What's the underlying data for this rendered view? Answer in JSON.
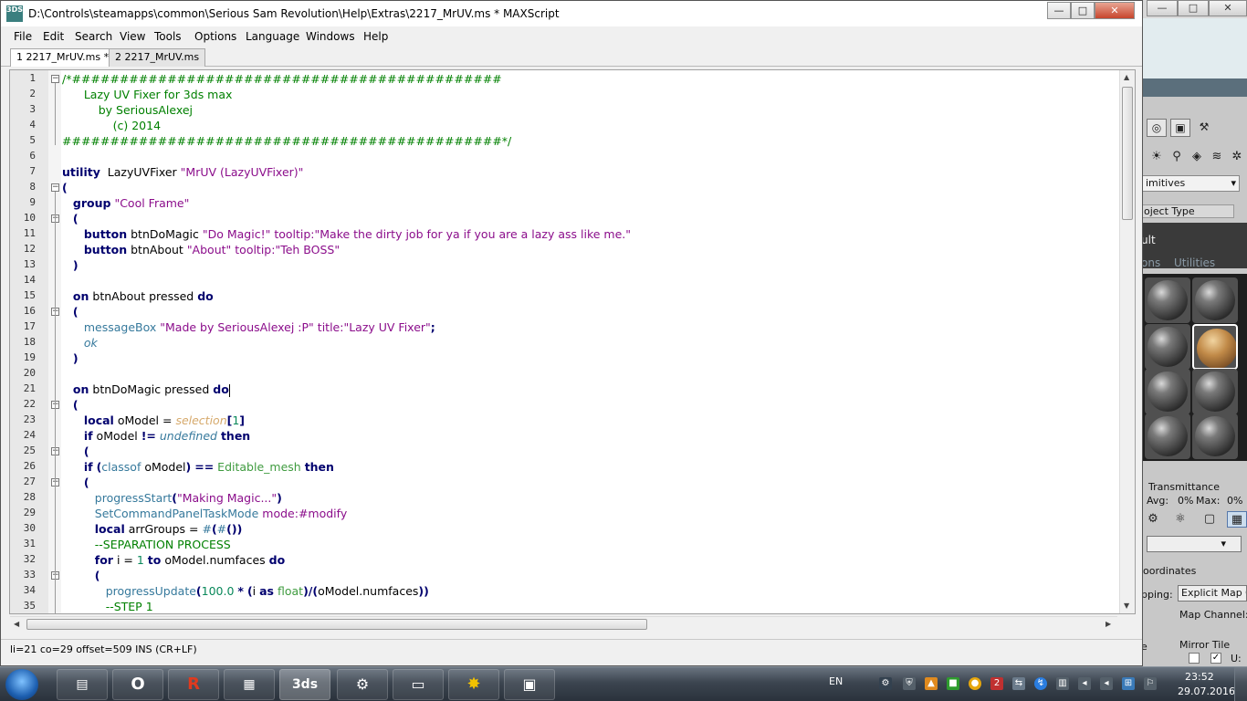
{
  "window": {
    "title": "D:\\Controls\\steamapps\\common\\Serious Sam Revolution\\Help\\Extras\\2217_MrUV.ms * MAXScript",
    "app_icon_text": "3DS",
    "minimize": "—",
    "maximize": "□",
    "close": "✕"
  },
  "menu": [
    "File",
    "Edit",
    "Search",
    "View",
    "Tools",
    "Options",
    "Language",
    "Windows",
    "Help"
  ],
  "tabs": [
    {
      "label": "1 2217_MrUV.ms *",
      "active": true
    },
    {
      "label": "2 2217_MrUV.ms",
      "active": false
    }
  ],
  "code": {
    "line_numbers": [
      "1",
      "2",
      "3",
      "4",
      "5",
      "6",
      "7",
      "8",
      "9",
      "10",
      "11",
      "12",
      "13",
      "14",
      "15",
      "16",
      "17",
      "18",
      "19",
      "20",
      "21",
      "22",
      "23",
      "24",
      "25",
      "26",
      "27",
      "28",
      "29",
      "30",
      "31",
      "32",
      "33",
      "34",
      "35"
    ],
    "lines": [
      [
        [
          "cm",
          "/*#############################################"
        ]
      ],
      [
        [
          "cm",
          "      Lazy UV Fixer for 3ds max"
        ]
      ],
      [
        [
          "cm",
          "          by SeriousAlexej"
        ]
      ],
      [
        [
          "cm",
          "              (c) 2014"
        ]
      ],
      [
        [
          "cm",
          "##############################################*/"
        ]
      ],
      [],
      [
        [
          "kw",
          "utility"
        ],
        [
          "",
          "  LazyUVFixer "
        ],
        [
          "str",
          "\"MrUV (LazyUVFixer)\""
        ]
      ],
      [
        [
          "kw",
          "("
        ]
      ],
      [
        [
          "",
          "   "
        ],
        [
          "kw",
          "group"
        ],
        [
          "",
          ""
        ],
        [
          "str",
          " \"Cool Frame\""
        ]
      ],
      [
        [
          "",
          "   "
        ],
        [
          "kw",
          "("
        ]
      ],
      [
        [
          "",
          "      "
        ],
        [
          "kw",
          "button"
        ],
        [
          "",
          " btnDoMagic "
        ],
        [
          "str",
          "\"Do Magic!\""
        ],
        [
          "",
          " "
        ],
        [
          "str",
          "tooltip:\"Make the dirty job for ya if you are a lazy ass like me.\""
        ]
      ],
      [
        [
          "",
          "      "
        ],
        [
          "kw",
          "button"
        ],
        [
          "",
          " btnAbout "
        ],
        [
          "str",
          "\"About\""
        ],
        [
          "",
          " "
        ],
        [
          "str",
          "tooltip:\"Teh BOSS\""
        ]
      ],
      [
        [
          "",
          "   "
        ],
        [
          "kw",
          ")"
        ]
      ],
      [],
      [
        [
          "",
          "   "
        ],
        [
          "kw",
          "on"
        ],
        [
          "",
          " btnAbout pressed "
        ],
        [
          "kw",
          "do"
        ]
      ],
      [
        [
          "",
          "   "
        ],
        [
          "kw",
          "("
        ]
      ],
      [
        [
          "",
          "      "
        ],
        [
          "fn",
          "messageBox"
        ],
        [
          "",
          " "
        ],
        [
          "str",
          "\"Made by SeriousAlexej :P\""
        ],
        [
          "",
          " "
        ],
        [
          "str",
          "title:\"Lazy UV Fixer\""
        ],
        [
          "kw",
          ";"
        ]
      ],
      [
        [
          "",
          "      "
        ],
        [
          "undef",
          "ok"
        ]
      ],
      [
        [
          "",
          "   "
        ],
        [
          "kw",
          ")"
        ]
      ],
      [],
      [
        [
          "",
          "   "
        ],
        [
          "kw",
          "on"
        ],
        [
          "",
          " btnDoMagic pressed "
        ],
        [
          "kw",
          "do"
        ],
        [
          "cursor",
          ""
        ]
      ],
      [
        [
          "",
          "   "
        ],
        [
          "kw",
          "("
        ]
      ],
      [
        [
          "",
          "      "
        ],
        [
          "kw",
          "local"
        ],
        [
          "",
          " oModel = "
        ],
        [
          "sel",
          "selection"
        ],
        [
          "kw",
          "["
        ],
        [
          "num",
          "1"
        ],
        [
          "kw",
          "]"
        ]
      ],
      [
        [
          "",
          "      "
        ],
        [
          "kw",
          "if"
        ],
        [
          "",
          " oModel "
        ],
        [
          "kw",
          "!="
        ],
        [
          "",
          " "
        ],
        [
          "undef",
          "undefined"
        ],
        [
          "",
          " "
        ],
        [
          "kw",
          "then"
        ]
      ],
      [
        [
          "",
          "      "
        ],
        [
          "kw",
          "("
        ]
      ],
      [
        [
          "",
          "      "
        ],
        [
          "kw",
          "if"
        ],
        [
          "",
          " "
        ],
        [
          "kw",
          "("
        ],
        [
          "fn",
          "classof"
        ],
        [
          "",
          " oModel"
        ],
        [
          "kw",
          ")"
        ],
        [
          "",
          " "
        ],
        [
          "kw",
          "=="
        ],
        [
          "",
          " "
        ],
        [
          "cls",
          "Editable_mesh"
        ],
        [
          "",
          " "
        ],
        [
          "kw",
          "then"
        ]
      ],
      [
        [
          "",
          "      "
        ],
        [
          "kw",
          "("
        ]
      ],
      [
        [
          "",
          "         "
        ],
        [
          "fn",
          "progressStart"
        ],
        [
          "kw",
          "("
        ],
        [
          "str",
          "\"Making Magic...\""
        ],
        [
          "kw",
          ")"
        ]
      ],
      [
        [
          "",
          "         "
        ],
        [
          "fn",
          "SetCommandPanelTaskMode"
        ],
        [
          "",
          " "
        ],
        [
          "str",
          "mode:#modify"
        ]
      ],
      [
        [
          "",
          "         "
        ],
        [
          "kw",
          "local"
        ],
        [
          "",
          " arrGroups = "
        ],
        [
          "fn",
          "#"
        ],
        [
          "kw",
          "("
        ],
        [
          "fn",
          "#"
        ],
        [
          "kw",
          "())"
        ]
      ],
      [
        [
          "",
          "         "
        ],
        [
          "cm",
          "--SEPARATION PROCESS"
        ]
      ],
      [
        [
          "",
          "         "
        ],
        [
          "kw",
          "for"
        ],
        [
          "",
          " i = "
        ],
        [
          "num",
          "1"
        ],
        [
          "",
          " "
        ],
        [
          "kw",
          "to"
        ],
        [
          "",
          " oModel.numfaces "
        ],
        [
          "kw",
          "do"
        ]
      ],
      [
        [
          "",
          "         "
        ],
        [
          "kw",
          "("
        ]
      ],
      [
        [
          "",
          "            "
        ],
        [
          "fn",
          "progressUpdate"
        ],
        [
          "kw",
          "("
        ],
        [
          "num",
          "100.0"
        ],
        [
          "",
          " "
        ],
        [
          "kw",
          "*"
        ],
        [
          "",
          " "
        ],
        [
          "kw",
          "("
        ],
        [
          "",
          "i "
        ],
        [
          "kw",
          "as"
        ],
        [
          "",
          " "
        ],
        [
          "cls",
          "float"
        ],
        [
          "kw",
          ")/("
        ],
        [
          "",
          "oModel.numfaces"
        ],
        [
          "kw",
          "))"
        ]
      ],
      [
        [
          "",
          "            "
        ],
        [
          "cm",
          "--STEP 1"
        ]
      ]
    ]
  },
  "status": "li=21 co=29 offset=509 INS (CR+LF)",
  "background_app": {
    "dropdown": "imitives",
    "rollout": "oject Type",
    "label_ult": "ult",
    "label_ons": "ons",
    "label_utilities": "Utilities",
    "transmittance": "Transmittance",
    "avg": "Avg:",
    "avg_val": "0%",
    "max": "Max:",
    "max_val": "0%",
    "coordinates": "oordinates",
    "mapping": "pping:",
    "mapping_value": "Explicit Map Ch",
    "map_channel": "Map Channel:",
    "mirror_tile": "Mirror Tile",
    "u_label": "U:",
    "e_label": "e"
  },
  "taskbar": {
    "language": "EN",
    "time": "23:52",
    "date": "29.07.2016"
  }
}
